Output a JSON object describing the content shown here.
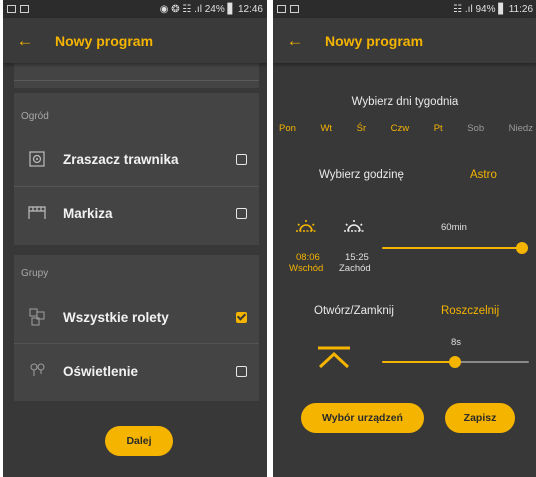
{
  "left": {
    "statusbar": {
      "right": "◉ ❂ ☷ .ıl 24% ▋ 12:46"
    },
    "appbar": {
      "back": "←",
      "title": "Nowy program"
    },
    "sections": [
      {
        "label": "Ogród",
        "items": [
          {
            "label": "Zraszacz trawnika",
            "icon": "sprinkler-icon",
            "checked": false
          },
          {
            "label": "Markiza",
            "icon": "awning-icon",
            "checked": false
          }
        ]
      },
      {
        "label": "Grupy",
        "items": [
          {
            "label": "Wszystkie rolety",
            "icon": "blinds-icon",
            "checked": true
          },
          {
            "label": "Oświetlenie",
            "icon": "lightbulb-icon",
            "checked": false
          }
        ]
      }
    ],
    "next_button": "Dalej"
  },
  "right": {
    "statusbar": {
      "right": "☷ .ıl 94% ▋ 11:26"
    },
    "appbar": {
      "back": "←",
      "title": "Nowy program"
    },
    "days_title": "Wybierz dni tygodnia",
    "days": [
      {
        "label": "Pon",
        "active": true
      },
      {
        "label": "Wt",
        "active": true
      },
      {
        "label": "Śr",
        "active": true
      },
      {
        "label": "Czw",
        "active": true
      },
      {
        "label": "Pt",
        "active": true
      },
      {
        "label": "Sob",
        "active": false
      },
      {
        "label": "Niedz",
        "active": false
      }
    ],
    "time_label": "Wybierz godzinę",
    "astro_label": "Astro",
    "sunrise": {
      "time": "08:06",
      "label": "Wschód"
    },
    "sunset": {
      "time": "15:25",
      "label": "Zachód"
    },
    "offset_slider": {
      "value_label": "60min",
      "fraction": 1.0
    },
    "action_label": "Otwórz/Zamknij",
    "action_value": "Roszczelnij",
    "duration_slider": {
      "value_label": "8s",
      "fraction": 0.5
    },
    "select_devices_button": "Wybór urządzeń",
    "save_button": "Zapisz"
  },
  "colors": {
    "accent": "#f5b400",
    "background": "#383838",
    "card": "#444444",
    "inactive": "#9a9a9a"
  }
}
